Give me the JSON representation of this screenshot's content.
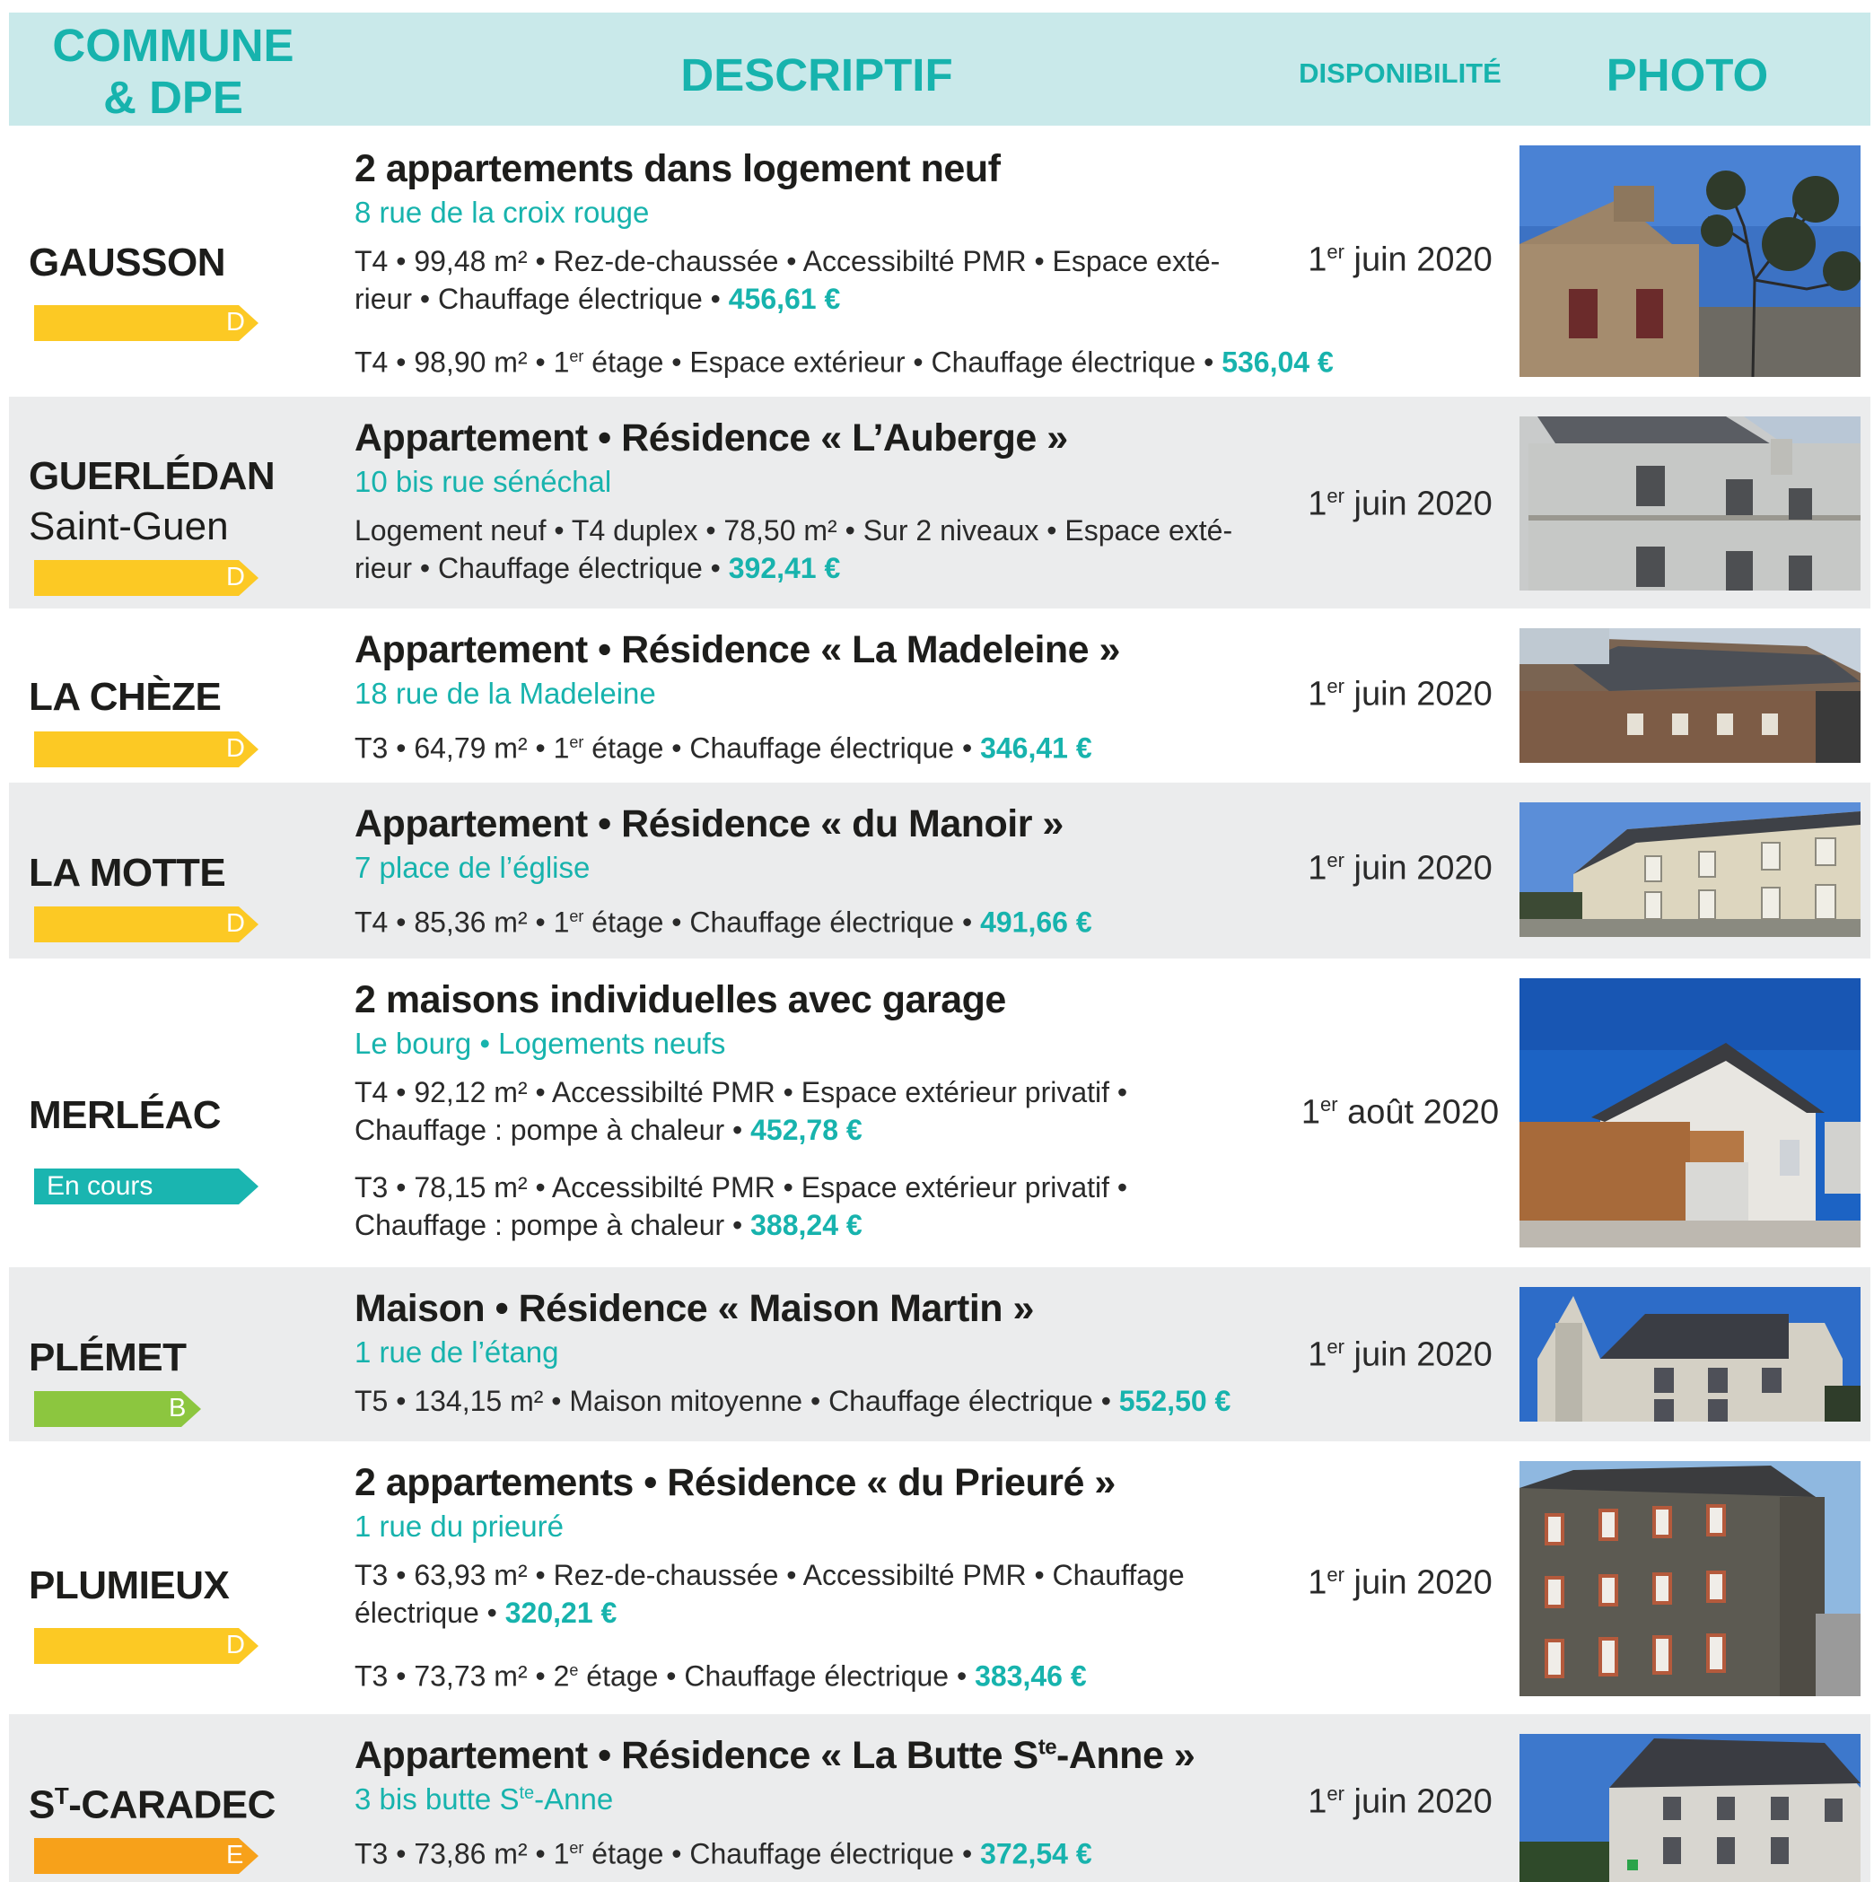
{
  "header": {
    "commune_line1": "COMMUNE",
    "commune_line2": "& DPE",
    "descriptif": "DESCRIPTIF",
    "disponibilite": "DISPONIBILITÉ",
    "photo": "PHOTO"
  },
  "colors": {
    "teal": "#17b3ad",
    "header_bg": "#c9e9ea",
    "alt_row": "#ebeced",
    "dpe_D": "#fcc924",
    "dpe_B": "#8cc63f",
    "dpe_E": "#f7a11a",
    "dpe_en_cours": "#1ab5b0"
  },
  "listings": [
    {
      "commune": "GAUSSON",
      "dpe": "D",
      "title": "2 appartements dans logement neuf",
      "address": "8 rue de la croix rouge",
      "lines": [
        {
          "l1": "T4 • 99,48 m² • Rez-de-chaussée • Accessibilté PMR • Espace exté-",
          "l2": "rieur • Chauffage électrique • ",
          "price": "456,61 €"
        },
        {
          "a": "T4 • 98,90 m² • 1",
          "sup": "er",
          "b": " étage • Espace extérieur • Chauffage électrique • ",
          "price": "536,04 €"
        }
      ],
      "dispo_day": "1",
      "dispo_sup": "er",
      "dispo_rest": " juin 2020",
      "photo": "stone-house-with-tree"
    },
    {
      "commune": "GUERLÉDAN",
      "commune_sub": "Saint-Guen",
      "dpe": "D",
      "title": "Appartement • Résidence « L’Auberge »",
      "address": "10 bis rue sénéchal",
      "lines": [
        {
          "l1": "Logement neuf • T4 duplex • 78,50 m² • Sur 2 niveaux • Espace exté-",
          "l2": "rieur • Chauffage électrique • ",
          "price": "392,41 €"
        }
      ],
      "dispo_day": "1",
      "dispo_sup": "er",
      "dispo_rest": " juin 2020",
      "photo": "grey-residence"
    },
    {
      "commune": "LA CHÈZE",
      "dpe": "D",
      "title": "Appartement • Résidence « La Madeleine »",
      "address": "18 rue de la Madeleine",
      "lines": [
        {
          "a": "T3 • 64,79 m² • 1",
          "sup": "er",
          "b": " étage • Chauffage électrique • ",
          "price": "346,41 €"
        }
      ],
      "dispo_day": "1",
      "dispo_sup": "er",
      "dispo_rest": " juin 2020",
      "photo": "stone-long-house"
    },
    {
      "commune": "LA MOTTE",
      "dpe": "D",
      "title": "Appartement • Résidence « du Manoir »",
      "address": "7 place de l’église",
      "lines": [
        {
          "a": "T4 • 85,36 m² • 1",
          "sup": "er",
          "b": " étage • Chauffage électrique • ",
          "price": "491,66 €"
        }
      ],
      "dispo_day": "1",
      "dispo_sup": "er",
      "dispo_rest": " juin 2020",
      "photo": "cream-manor"
    },
    {
      "commune": "MERLÉAC",
      "dpe": "En cours",
      "title": "2 maisons individuelles avec garage",
      "address": "Le bourg • Logements neufs",
      "lines": [
        {
          "l1": "T4 • 92,12 m² • Accessibilté PMR • Espace extérieur privatif •",
          "l2": "Chauffage : pompe à chaleur • ",
          "price": "452,78 €"
        },
        {
          "l1": "T3 • 78,15 m² • Accessibilté PMR • Espace extérieur privatif •",
          "l2": "Chauffage : pompe à chaleur • ",
          "price": "388,24 €"
        }
      ],
      "dispo_day": "1",
      "dispo_sup": "er",
      "dispo_rest": " août 2020",
      "photo": "new-house-with-garage"
    },
    {
      "commune": "PLÉMET",
      "dpe": "B",
      "title": "Maison • Résidence « Maison Martin »",
      "address": "1 rue de l’étang",
      "lines": [
        {
          "a": "T5 • 134,15 m² • Maison mitoyenne • Chauffage électrique • ",
          "price": "552,50 €"
        }
      ],
      "dispo_day": "1",
      "dispo_sup": "er",
      "dispo_rest": " juin 2020",
      "photo": "breton-house-blue-sky"
    },
    {
      "commune": "PLUMIEUX",
      "dpe": "D",
      "title": "2 appartements • Résidence « du Prieuré »",
      "address": "1 rue du prieuré",
      "lines": [
        {
          "l1": "T3 • 63,93 m² • Rez-de-chaussée • Accessibilté PMR •  Chauffage",
          "l2": "électrique • ",
          "price": "320,21 €"
        },
        {
          "a": "T3 • 73,73 m² • 2",
          "sup": "e",
          "b": " étage • Chauffage électrique • ",
          "price": "383,46 €"
        }
      ],
      "dispo_day": "1",
      "dispo_sup": "er",
      "dispo_rest": " juin 2020",
      "photo": "stone-priory-building"
    },
    {
      "commune_a": "S",
      "commune_sup": "T",
      "commune_b": "-CARADEC",
      "dpe": "E",
      "title_a": "Appartement • Résidence « La Butte S",
      "title_sup": "te",
      "title_b": "-Anne »",
      "address_a": "3 bis butte S",
      "address_sup": "te",
      "address_b": "-Anne",
      "lines": [
        {
          "a": "T3 • 73,86 m² • 1",
          "sup": "er",
          "b": " étage • Chauffage électrique • ",
          "price": "372,54 €"
        }
      ],
      "dispo_day": "1",
      "dispo_sup": "er",
      "dispo_rest": " juin 2020",
      "photo": "residence-with-dormers"
    }
  ]
}
